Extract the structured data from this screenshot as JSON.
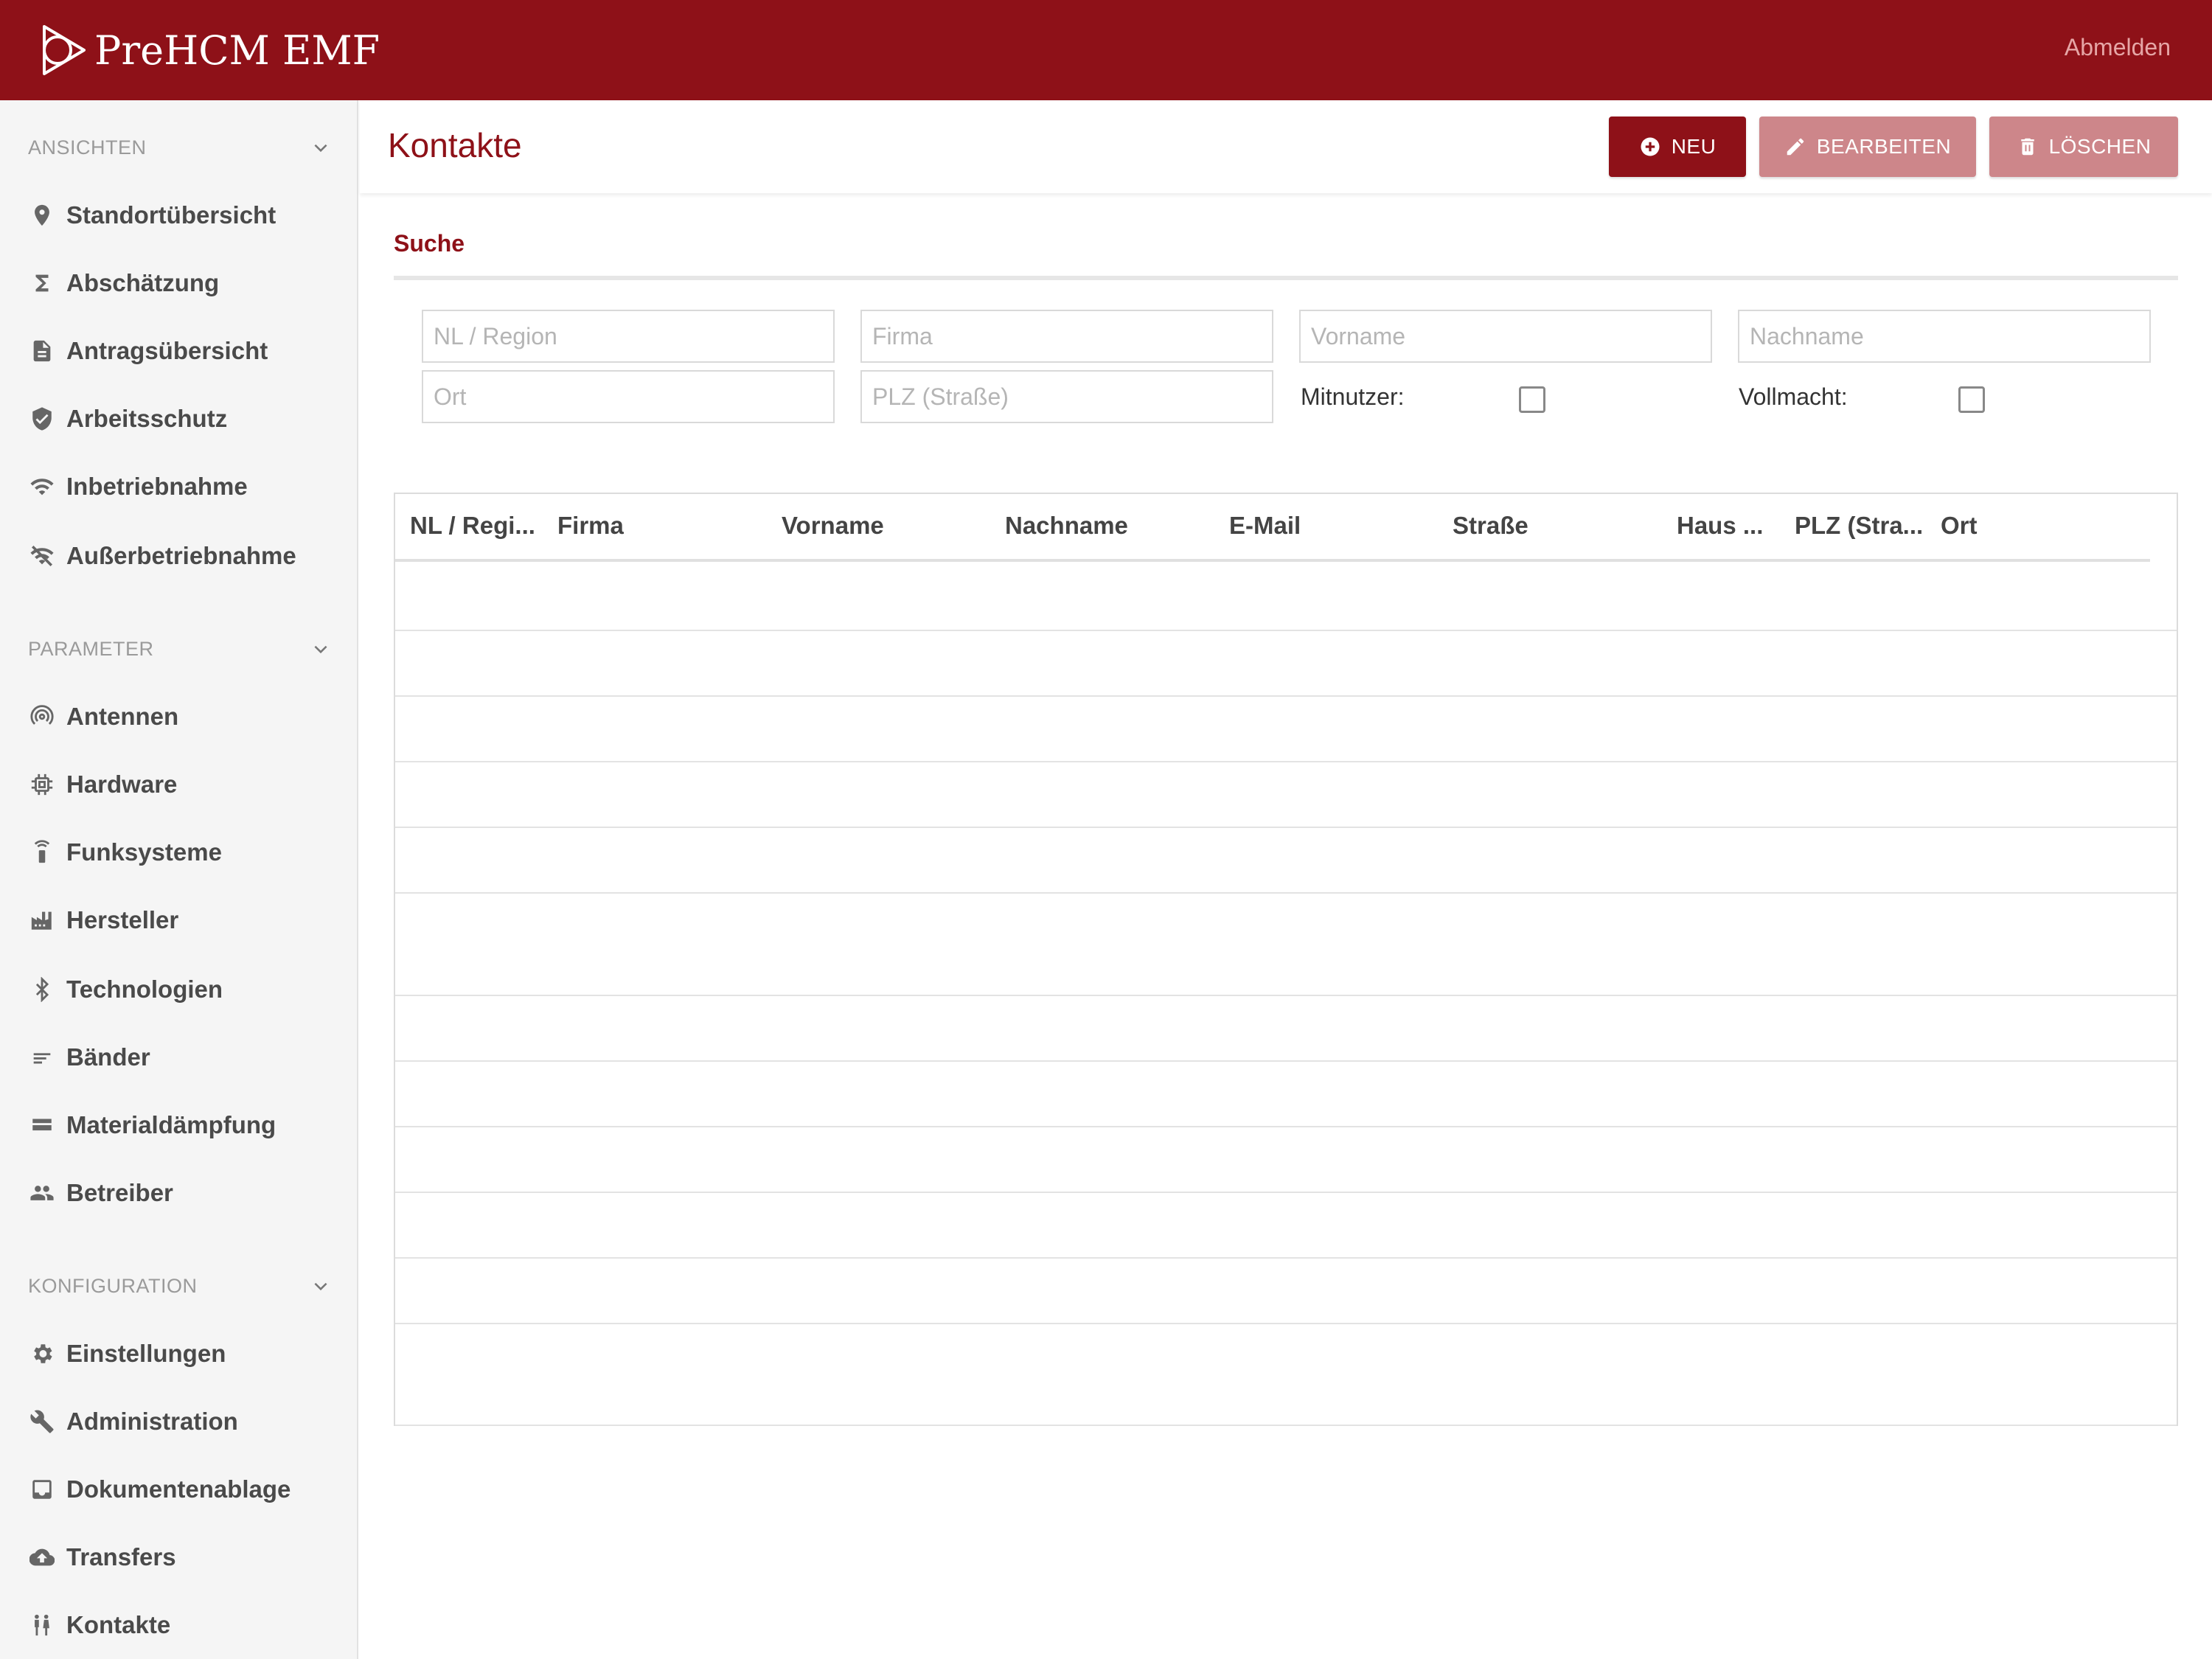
{
  "app": {
    "brand": "PreHCM  EMF",
    "logout_label": "Abmelden"
  },
  "sidebar": {
    "sections": [
      {
        "title": "ANSICHTEN",
        "items": [
          {
            "label": "Standortübersicht",
            "icon": "map-pin-icon"
          },
          {
            "label": "Abschätzung",
            "icon": "sigma-icon"
          },
          {
            "label": "Antragsübersicht",
            "icon": "document-icon"
          },
          {
            "label": "Arbeitsschutz",
            "icon": "shield-icon"
          },
          {
            "label": "Inbetriebnahme",
            "icon": "wifi-icon"
          },
          {
            "label": "Außerbetriebnahme",
            "icon": "wifi-off-icon"
          }
        ]
      },
      {
        "title": "PARAMETER",
        "items": [
          {
            "label": "Antennen",
            "icon": "antenna-icon"
          },
          {
            "label": "Hardware",
            "icon": "chip-icon"
          },
          {
            "label": "Funksysteme",
            "icon": "radio-tower-icon"
          },
          {
            "label": "Hersteller",
            "icon": "factory-icon"
          },
          {
            "label": "Technologien",
            "icon": "bluetooth-icon"
          },
          {
            "label": "Bänder",
            "icon": "lines-icon"
          },
          {
            "label": "Materialdämpfung",
            "icon": "material-icon"
          },
          {
            "label": "Betreiber",
            "icon": "people-icon"
          }
        ]
      },
      {
        "title": "KONFIGURATION",
        "items": [
          {
            "label": "Einstellungen",
            "icon": "gear-icon"
          },
          {
            "label": "Administration",
            "icon": "wrench-icon"
          },
          {
            "label": "Dokumentenablage",
            "icon": "inbox-icon"
          },
          {
            "label": "Transfers",
            "icon": "cloud-upload-icon"
          },
          {
            "label": "Kontakte",
            "icon": "contacts-icon"
          }
        ]
      }
    ]
  },
  "main": {
    "title": "Kontakte",
    "buttons": {
      "new": "NEU",
      "edit": "BEARBEITEN",
      "delete": "LÖSCHEN"
    },
    "search": {
      "title": "Suche",
      "placeholders": {
        "region": "NL / Region",
        "firma": "Firma",
        "vorname": "Vorname",
        "nachname": "Nachname",
        "ort": "Ort",
        "plz": "PLZ (Straße)"
      },
      "values": {
        "region": "",
        "firma": "",
        "vorname": "",
        "nachname": "",
        "ort": "",
        "plz": ""
      },
      "mitnutzer_label": "Mitnutzer:",
      "vollmacht_label": "Vollmacht:",
      "mitnutzer_checked": false,
      "vollmacht_checked": false
    },
    "table": {
      "columns": [
        "NL / Regi...",
        "Firma",
        "Vorname",
        "Nachname",
        "E-Mail",
        "Straße",
        "Haus ...",
        "PLZ (Stra...",
        "Ort"
      ],
      "rows": []
    }
  },
  "colors": {
    "brand": "#8e1118",
    "button_disabled": "#cd868a",
    "sidebar_bg": "#f5f5f5"
  }
}
